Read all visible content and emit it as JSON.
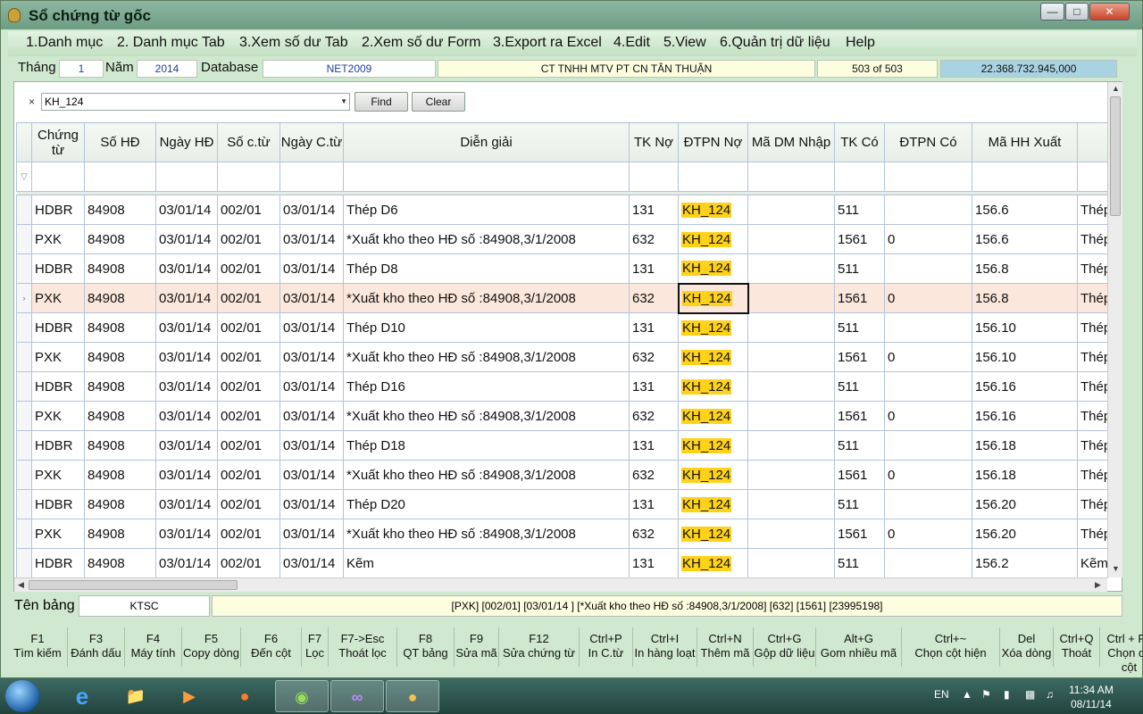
{
  "window": {
    "title": "Sổ chứng từ gốc"
  },
  "menu": [
    "1.Danh mục",
    "2. Danh mục Tab",
    "3.Xem số dư Tab",
    "2.Xem số dư Form",
    "3.Export ra Excel",
    "4.Edit",
    "5.View",
    "6.Quản trị dữ liệu",
    "Help"
  ],
  "info": {
    "thang_label": "Tháng",
    "thang_value": "1",
    "nam_label": "Năm",
    "nam_value": "2014",
    "db_label": "Database",
    "db_value": "NET2009",
    "company": "CT TNHH MTV PT CN TÂN THUẬN",
    "record": "503 of 503",
    "total": "22.368.732.945,000"
  },
  "find": {
    "x": "×",
    "value": "KH_124",
    "find_label": "Find",
    "clear_label": "Clear"
  },
  "columns": [
    "Chứng từ",
    "Số HĐ",
    "Ngày HĐ",
    "Số c.từ",
    "Ngày C.từ",
    "Diễn giải",
    "TK Nợ",
    "ĐTPN Nợ",
    "Mã DM Nhập",
    "TK Có",
    "ĐTPN Có",
    "Mã HH Xuất",
    ""
  ],
  "rows": [
    [
      "HDBR",
      "84908",
      "03/01/14",
      "002/01",
      "03/01/14",
      "Thép D6",
      "131",
      "KH_124",
      "",
      "511",
      "",
      "156.6",
      "Thép"
    ],
    [
      "PXK",
      "84908",
      "03/01/14",
      "002/01",
      "03/01/14",
      "*Xuất kho theo  HĐ số :84908,3/1/2008",
      "632",
      "KH_124",
      "",
      "1561",
      "0",
      "156.6",
      "Thép"
    ],
    [
      "HDBR",
      "84908",
      "03/01/14",
      "002/01",
      "03/01/14",
      "Thép D8",
      "131",
      "KH_124",
      "",
      "511",
      "",
      "156.8",
      "Thép"
    ],
    [
      "PXK",
      "84908",
      "03/01/14",
      "002/01",
      "03/01/14",
      "*Xuất kho theo  HĐ số :84908,3/1/2008",
      "632",
      "KH_124",
      "",
      "1561",
      "0",
      "156.8",
      "Thép"
    ],
    [
      "HDBR",
      "84908",
      "03/01/14",
      "002/01",
      "03/01/14",
      "Thép D10",
      "131",
      "KH_124",
      "",
      "511",
      "",
      "156.10",
      "Thép"
    ],
    [
      "PXK",
      "84908",
      "03/01/14",
      "002/01",
      "03/01/14",
      "*Xuất kho theo  HĐ số :84908,3/1/2008",
      "632",
      "KH_124",
      "",
      "1561",
      "0",
      "156.10",
      "Thép"
    ],
    [
      "HDBR",
      "84908",
      "03/01/14",
      "002/01",
      "03/01/14",
      "Thép D16",
      "131",
      "KH_124",
      "",
      "511",
      "",
      "156.16",
      "Thép"
    ],
    [
      "PXK",
      "84908",
      "03/01/14",
      "002/01",
      "03/01/14",
      "*Xuất kho theo  HĐ số :84908,3/1/2008",
      "632",
      "KH_124",
      "",
      "1561",
      "0",
      "156.16",
      "Thép"
    ],
    [
      "HDBR",
      "84908",
      "03/01/14",
      "002/01",
      "03/01/14",
      "Thép D18",
      "131",
      "KH_124",
      "",
      "511",
      "",
      "156.18",
      "Thép"
    ],
    [
      "PXK",
      "84908",
      "03/01/14",
      "002/01",
      "03/01/14",
      "*Xuất kho theo  HĐ số :84908,3/1/2008",
      "632",
      "KH_124",
      "",
      "1561",
      "0",
      "156.18",
      "Thép"
    ],
    [
      "HDBR",
      "84908",
      "03/01/14",
      "002/01",
      "03/01/14",
      "Thép D20",
      "131",
      "KH_124",
      "",
      "511",
      "",
      "156.20",
      "Thép"
    ],
    [
      "PXK",
      "84908",
      "03/01/14",
      "002/01",
      "03/01/14",
      "*Xuất kho theo  HĐ số :84908,3/1/2008",
      "632",
      "KH_124",
      "",
      "1561",
      "0",
      "156.20",
      "Thép"
    ],
    [
      "HDBR",
      "84908",
      "03/01/14",
      "002/01",
      "03/01/14",
      "Kẽm",
      "131",
      "KH_124",
      "",
      "511",
      "",
      "156.2",
      "Kẽm"
    ]
  ],
  "current_row": 3,
  "status": {
    "label": "Tên bảng",
    "table": "KTSC",
    "info": "[PXK]   [002/01]   [03/01/14 ]   [*Xuất kho theo  HĐ số :84908,3/1/2008]   [632]  [1561]  [23995198]"
  },
  "fkeys": [
    [
      "F1",
      "Tìm kiếm"
    ],
    [
      "F3",
      "Đánh dấu"
    ],
    [
      "F4",
      "Máy tính"
    ],
    [
      "F5",
      "Copy dòng"
    ],
    [
      "F6",
      "Đến cột"
    ],
    [
      "F7",
      "Lọc"
    ],
    [
      "F7->Esc",
      "Thoát lọc"
    ],
    [
      "F8",
      "QT bảng"
    ],
    [
      "F9",
      "Sửa mã"
    ],
    [
      "F12",
      "Sửa chứng từ"
    ],
    [
      "Ctrl+P",
      "In C.từ"
    ],
    [
      "Ctrl+I",
      "In hàng loạt"
    ],
    [
      "Ctrl+N",
      "Thêm mã"
    ],
    [
      "Ctrl+G",
      "Gộp dữ liệu"
    ],
    [
      "Alt+G",
      "Gom nhiều mã"
    ],
    [
      "Ctrl+~",
      "Chọn cột hiện"
    ],
    [
      "Del",
      "Xóa dòng"
    ],
    [
      "Ctrl+Q",
      "Thoát"
    ],
    [
      "Ctrl + F2",
      "Chọn ds cột"
    ]
  ],
  "taskbar": {
    "lang": "EN",
    "time": "11:34 AM",
    "date": "08/11/14"
  },
  "colors": {
    "highlight": "#ffd21a",
    "current_row": "#fbe7dc",
    "accent": "#1f3fa0"
  }
}
